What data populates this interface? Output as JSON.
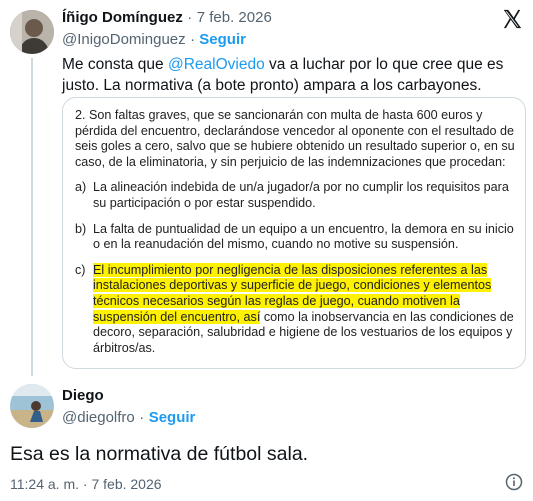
{
  "tweet1": {
    "author_name": "Íñigo Domínguez",
    "separator": "·",
    "date": "7 feb. 2026",
    "handle": "@InigoDominguez",
    "follow": "Seguir",
    "text_before_mention": "Me consta que ",
    "mention": "@RealOviedo",
    "text_line1_after": " va a luchar por lo que cree que es",
    "text_line2": "justo. La normativa (a bote pronto) ampara a los carbayones."
  },
  "document": {
    "intro": "2. Son faltas graves, que se sancionarán con multa de hasta 600 euros y pérdida del encuentro, declarándose vencedor al oponente con el resultado de seis goles a cero, salvo que se hubiere obtenido un resultado superior o, en su caso, de la eliminatoria, y sin perjuicio de las indemnizaciones que procedan:",
    "items": [
      {
        "label": "a)",
        "text": "La alineación indebida de un/a jugador/a por no cumplir los requisitos para su participación o por estar suspendido."
      },
      {
        "label": "b)",
        "text": "La falta de puntualidad de un equipo a un encuentro, la demora en su inicio o en la reanudación del mismo, cuando no motive su suspensión."
      },
      {
        "label": "c)",
        "highlighted": "El incumplimiento por negligencia de las disposiciones referentes a las instalaciones deportivas y superficie de juego, condiciones y elementos técnicos necesarios según las reglas de juego, cuando motiven la suspensión del encuentro, así",
        "rest": " como la inobservancia en las condiciones de decoro, separación, salubridad e higiene de los vestuarios de los equipos y árbitros/as."
      }
    ]
  },
  "tweet2": {
    "author_name": "Diego",
    "handle": "@diegolfro",
    "separator": "·",
    "follow": "Seguir",
    "text": "Esa es la normativa de fútbol sala.",
    "time": "11:24 a. m.",
    "date": "7 feb. 2026"
  },
  "colors": {
    "accent": "#1d9bf0",
    "highlight": "#fff200",
    "muted": "#536471"
  }
}
